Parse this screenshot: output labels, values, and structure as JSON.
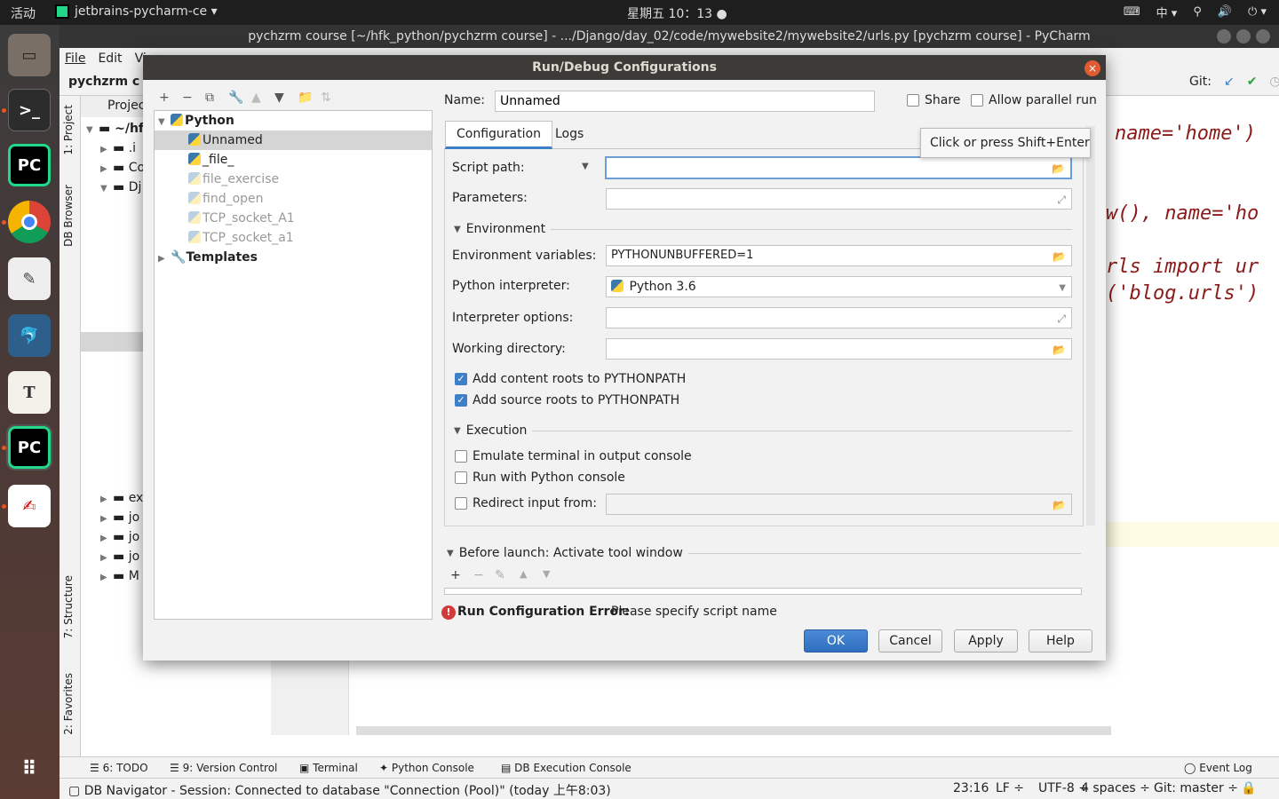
{
  "topbar": {
    "activities": "活动",
    "app": "jetbrains-pycharm-ce ▾",
    "clock": "星期五 10：13 ●",
    "tray": [
      "⌨",
      "中 ▾",
      "⚲",
      "🔊",
      "⏻ ▾"
    ]
  },
  "window": {
    "title": "pychzrm course [~/hfk_python/pychzrm course] - .../Django/day_02/code/mywebsite2/mywebsite2/urls.py [pychzrm course] - PyCharm"
  },
  "menu": [
    "File",
    "Edit",
    "Vi"
  ],
  "navbar": {
    "crumb": "pychzrm c",
    "git_label": "Git:"
  },
  "side_tabs": {
    "project": "1: Project",
    "db": "DB Browser",
    "structure": "7: Structure",
    "favorites": "2: Favorites"
  },
  "project_panel": {
    "header": "Projec",
    "rows": [
      "~/hfl",
      ".i",
      "Co",
      "Dj",
      "ex",
      "jo",
      "jo",
      "jo",
      "M"
    ]
  },
  "editor": {
    "lines": [
      "name='home')",
      "w(), name='ho",
      "rls import ur",
      "('blog.urls')"
    ]
  },
  "dialog": {
    "title": "Run/Debug Configurations",
    "close": "×",
    "toolbar": [
      "+",
      "−",
      "⧉",
      "🔧",
      "▲",
      "▼",
      "📁",
      "⇅"
    ],
    "tree": {
      "python": "Python",
      "items": [
        {
          "label": "Unnamed",
          "selected": true,
          "faded": false
        },
        {
          "label": "_file_",
          "selected": false,
          "faded": false
        },
        {
          "label": "file_exercise",
          "selected": false,
          "faded": true
        },
        {
          "label": "find_open",
          "selected": false,
          "faded": true
        },
        {
          "label": "TCP_socket_A1",
          "selected": false,
          "faded": true
        },
        {
          "label": "TCP_socket_a1",
          "selected": false,
          "faded": true
        }
      ],
      "templates": "Templates"
    },
    "name_label": "Name:",
    "name_value": "Unnamed",
    "share_label": "Share",
    "parallel_label": "Allow parallel run",
    "tabs": {
      "configuration": "Configuration",
      "logs": "Logs"
    },
    "tooltip": "Click or press Shift+Enter",
    "script_path_label": "Script path:",
    "script_path_value": "",
    "parameters_label": "Parameters:",
    "environment_section": "Environment",
    "env_vars_label": "Environment variables:",
    "env_vars_value": "PYTHONUNBUFFERED=1",
    "interpreter_label": "Python interpreter:",
    "interpreter_value": "Python 3.6",
    "interp_options_label": "Interpreter options:",
    "working_dir_label": "Working directory:",
    "content_roots_label": "Add content roots to PYTHONPATH",
    "content_roots_checked": true,
    "source_roots_label": "Add source roots to PYTHONPATH",
    "source_roots_checked": true,
    "execution_section": "Execution",
    "emulate_label": "Emulate terminal in output console",
    "python_console_label": "Run with Python console",
    "redirect_label": "Redirect input from:",
    "before_launch": "Before launch: Activate tool window",
    "error_title": "Run Configuration Error:",
    "error_text": "Please specify script name",
    "buttons": {
      "ok": "OK",
      "cancel": "Cancel",
      "apply": "Apply",
      "help": "Help"
    }
  },
  "bottom_tabs": [
    "6: TODO",
    "9: Version Control",
    "Terminal",
    "Python Console",
    "DB Execution Console",
    "Event Log"
  ],
  "status": {
    "left": "DB Navigator - Session: Connected to database \"Connection (Pool)\" (today 上午8:03)",
    "position": "23:16",
    "line_sep": "LF ÷",
    "encoding": "UTF-8 ÷",
    "indent": "4 spaces ÷",
    "git": "Git: master ÷"
  },
  "colors": {
    "accent": "#3d7fc9",
    "error": "#d33a3a",
    "close": "#e05a32",
    "code": "#8b1a1a"
  }
}
